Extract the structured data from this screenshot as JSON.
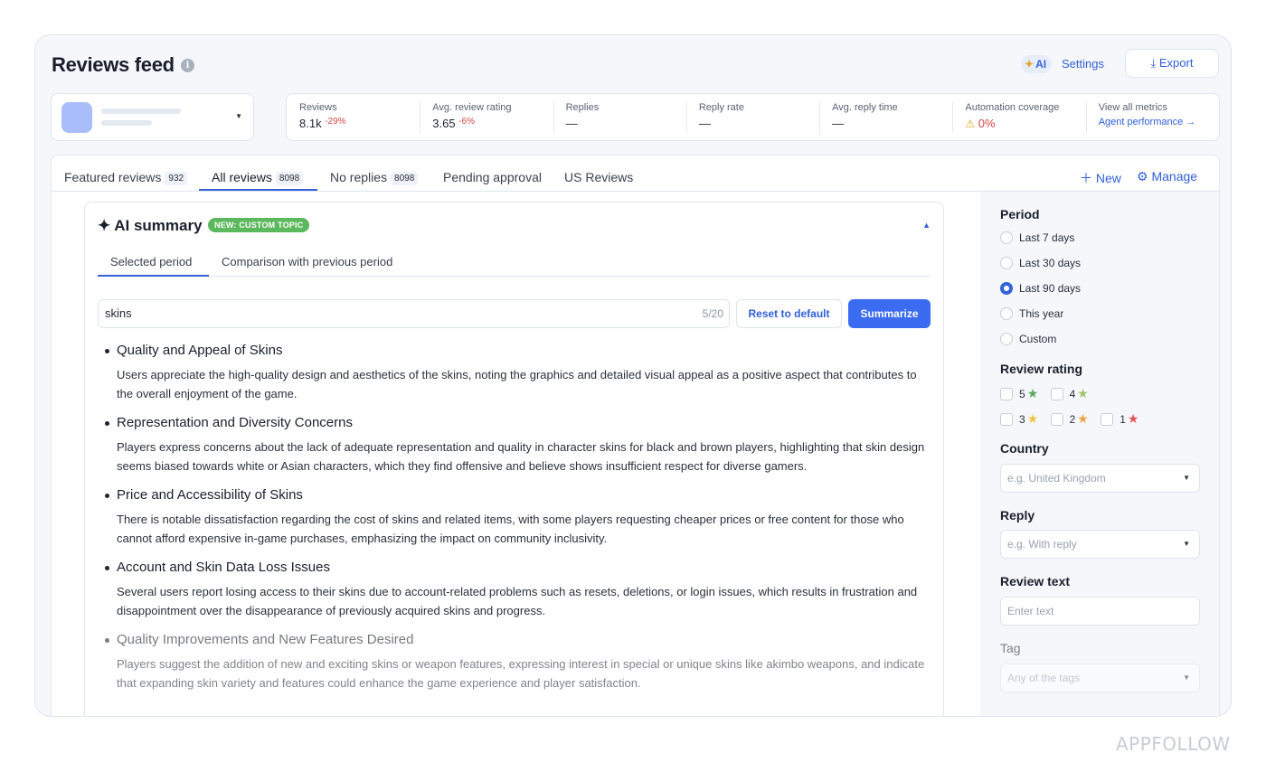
{
  "header": {
    "title": "Reviews feed",
    "info_glyph": "i",
    "ai_badge": "AI",
    "settings_label": "Settings",
    "export_label": "Export"
  },
  "metrics": [
    {
      "label": "Reviews",
      "value": "8.1k",
      "delta": "-29%"
    },
    {
      "label": "Avg. review rating",
      "value": "3.65",
      "delta": "-6%"
    },
    {
      "label": "Replies",
      "value": "—",
      "delta": ""
    },
    {
      "label": "Reply rate",
      "value": "—",
      "delta": ""
    },
    {
      "label": "Avg. reply time",
      "value": "—",
      "delta": ""
    },
    {
      "label": "Automation coverage",
      "value": "0%",
      "delta": ""
    },
    {
      "label": "View all metrics",
      "value": "Agent performance →",
      "delta": ""
    }
  ],
  "tabs": [
    {
      "label": "Featured reviews",
      "count": "932"
    },
    {
      "label": "All reviews",
      "count": "8098"
    },
    {
      "label": "No replies",
      "count": "8098"
    },
    {
      "label": "Pending approval",
      "count": ""
    },
    {
      "label": "US Reviews",
      "count": ""
    }
  ],
  "tab_actions": {
    "new_label": "New",
    "manage_label": "Manage"
  },
  "ai_summary": {
    "title": "AI summary",
    "badge": "NEW: CUSTOM TOPIC",
    "sub_tabs": [
      "Selected period",
      "Comparison with previous period"
    ],
    "topic_value": "skins",
    "topic_counter": "5/20",
    "reset_label": "Reset to default",
    "summarize_label": "Summarize",
    "items": [
      {
        "heading": "Quality and Appeal of Skins",
        "body": "Users appreciate the high-quality design and aesthetics of the skins, noting the graphics and detailed visual appeal as a positive aspect that contributes to the overall enjoyment of the game."
      },
      {
        "heading": "Representation and Diversity Concerns",
        "body": "Players express concerns about the lack of adequate representation and quality in character skins for black and brown players, highlighting that skin design seems biased towards white or Asian characters, which they find offensive and believe shows insufficient respect for diverse gamers."
      },
      {
        "heading": "Price and Accessibility of Skins",
        "body": "There is notable dissatisfaction regarding the cost of skins and related items, with some players requesting cheaper prices or free content for those who cannot afford expensive in-game purchases, emphasizing the impact on community inclusivity."
      },
      {
        "heading": "Account and Skin Data Loss Issues",
        "body": "Several users report losing access to their skins due to account-related problems such as resets, deletions, or login issues, which results in frustration and disappointment over the disappearance of previously acquired skins and progress."
      },
      {
        "heading": "Quality Improvements and New Features Desired",
        "body": "Players suggest the addition of new and exciting skins or weapon features, expressing interest in special or unique skins like akimbo weapons, and indicate that expanding skin variety and features could enhance the game experience and player satisfaction."
      }
    ]
  },
  "filters": {
    "period_label": "Period",
    "period_options": [
      "Last 7 days",
      "Last 30 days",
      "Last 90 days",
      "This year",
      "Custom"
    ],
    "period_selected": "Last 90 days",
    "rating_label": "Review rating",
    "ratings": [
      {
        "value": "5",
        "color": "#5aa85e"
      },
      {
        "value": "4",
        "color": "#9cc46a"
      },
      {
        "value": "3",
        "color": "#f0c341"
      },
      {
        "value": "2",
        "color": "#f0a142"
      },
      {
        "value": "1",
        "color": "#e0555a"
      }
    ],
    "country_label": "Country",
    "country_placeholder": "e.g. United Kingdom",
    "reply_label": "Reply",
    "reply_placeholder": "e.g. With reply",
    "review_text_label": "Review text",
    "review_text_placeholder": "Enter text",
    "tag_label": "Tag",
    "tag_placeholder": "Any of the tags"
  },
  "watermark": "APPFOLLOW"
}
